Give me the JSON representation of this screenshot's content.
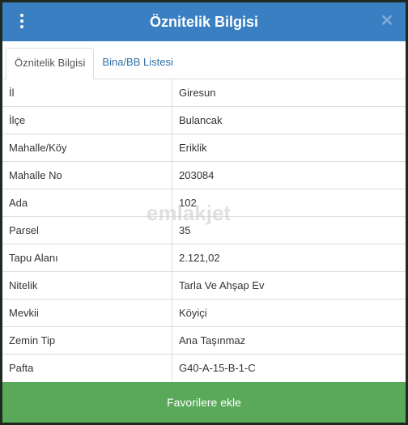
{
  "header": {
    "title": "Öznitelik Bilgisi",
    "close_glyph": "✕",
    "accent": "#3a7fc2"
  },
  "tabs": [
    {
      "label": "Öznitelik Bilgisi",
      "active": true
    },
    {
      "label": "Bina/BB Listesi",
      "active": false
    }
  ],
  "rows": [
    {
      "key": "İl",
      "value": "Giresun"
    },
    {
      "key": "İlçe",
      "value": "Bulancak"
    },
    {
      "key": "Mahalle/Köy",
      "value": "Eriklik"
    },
    {
      "key": "Mahalle No",
      "value": "203084"
    },
    {
      "key": "Ada",
      "value": "102"
    },
    {
      "key": "Parsel",
      "value": "35"
    },
    {
      "key": "Tapu Alanı",
      "value": "2.121,02"
    },
    {
      "key": "Nitelik",
      "value": "Tarla Ve Ahşap Ev"
    },
    {
      "key": "Mevkii",
      "value": "Köyiçi"
    },
    {
      "key": "Zemin Tip",
      "value": "Ana Taşınmaz"
    },
    {
      "key": "Pafta",
      "value": "G40-A-15-B-1-C"
    }
  ],
  "watermark": "emlakjet",
  "footer": {
    "button_label": "Favorilere ekle",
    "color": "#5aa95a"
  }
}
